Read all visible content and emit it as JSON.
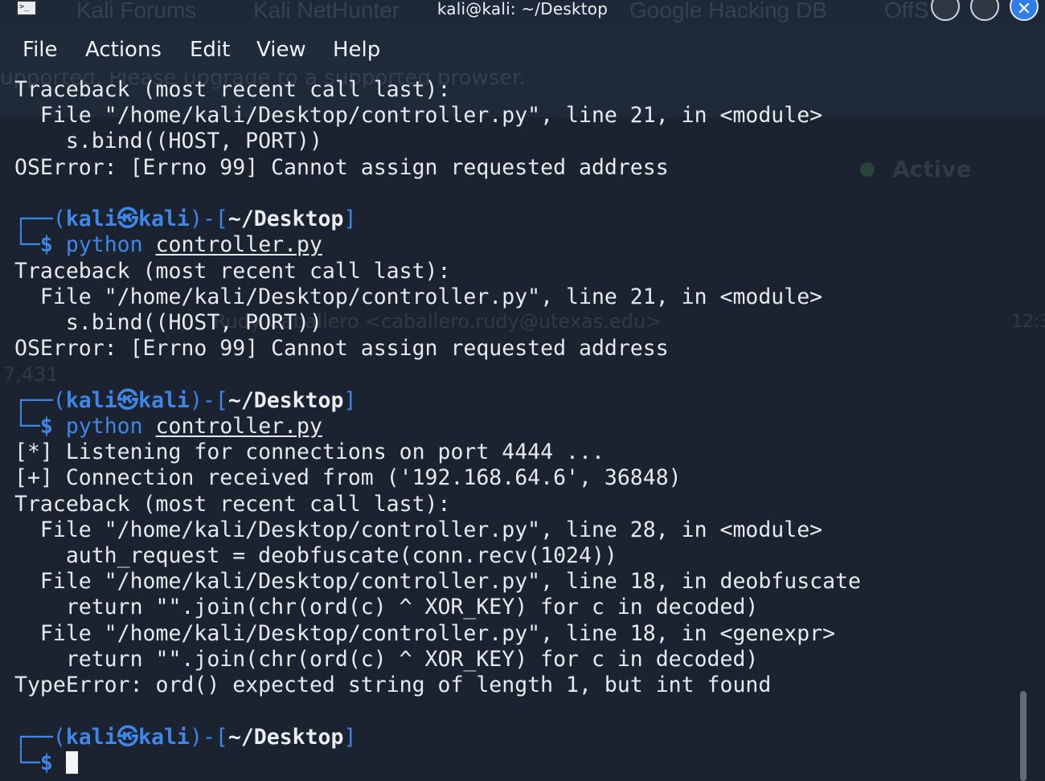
{
  "window": {
    "title": "kali@kali: ~/Desktop",
    "background_tabs": [
      "Kali Forums",
      "Kali NetHunter",
      "Google Hacking DB",
      "OffS"
    ]
  },
  "menu": {
    "items": [
      "File",
      "Actions",
      "Edit",
      "View",
      "Help"
    ]
  },
  "background_page": {
    "banner_text": "upported. Please upgrade to a supported browser.",
    "status": "Active",
    "sender": "Rudy Caballero <caballero.rudy@utexas.edu>",
    "count": "7,431",
    "time": "12:3"
  },
  "prompt": {
    "user": "kali",
    "host": "kali",
    "at_symbol": "㉿",
    "path": "~/Desktop",
    "symbol": "$"
  },
  "blocks": [
    {
      "prefix_lines": [
        "Traceback (most recent call last):",
        "  File \"/home/kali/Desktop/controller.py\", line 21, in <module>",
        "    s.bind((HOST, PORT))",
        "OSError: [Errno 99] Cannot assign requested address"
      ]
    },
    {
      "command_name": "python",
      "command_arg": "controller.py",
      "output": [
        "Traceback (most recent call last):",
        "  File \"/home/kali/Desktop/controller.py\", line 21, in <module>",
        "    s.bind((HOST, PORT))",
        "OSError: [Errno 99] Cannot assign requested address"
      ]
    },
    {
      "command_name": "python",
      "command_arg": "controller.py",
      "output": [
        "[*] Listening for connections on port 4444 ...",
        "[+] Connection received from ('192.168.64.6', 36848)",
        "Traceback (most recent call last):",
        "  File \"/home/kali/Desktop/controller.py\", line 28, in <module>",
        "    auth_request = deobfuscate(conn.recv(1024))",
        "  File \"/home/kali/Desktop/controller.py\", line 18, in deobfuscate",
        "    return \"\".join(chr(ord(c) ^ XOR_KEY) for c in decoded)",
        "  File \"/home/kali/Desktop/controller.py\", line 18, in <genexpr>",
        "    return \"\".join(chr(ord(c) ^ XOR_KEY) for c in decoded)",
        "TypeError: ord() expected string of length 1, but int found"
      ]
    }
  ],
  "colors": {
    "terminal_bg": "#1b2330",
    "prompt_blue": "#3f86e6",
    "text": "#e6e9ee"
  }
}
